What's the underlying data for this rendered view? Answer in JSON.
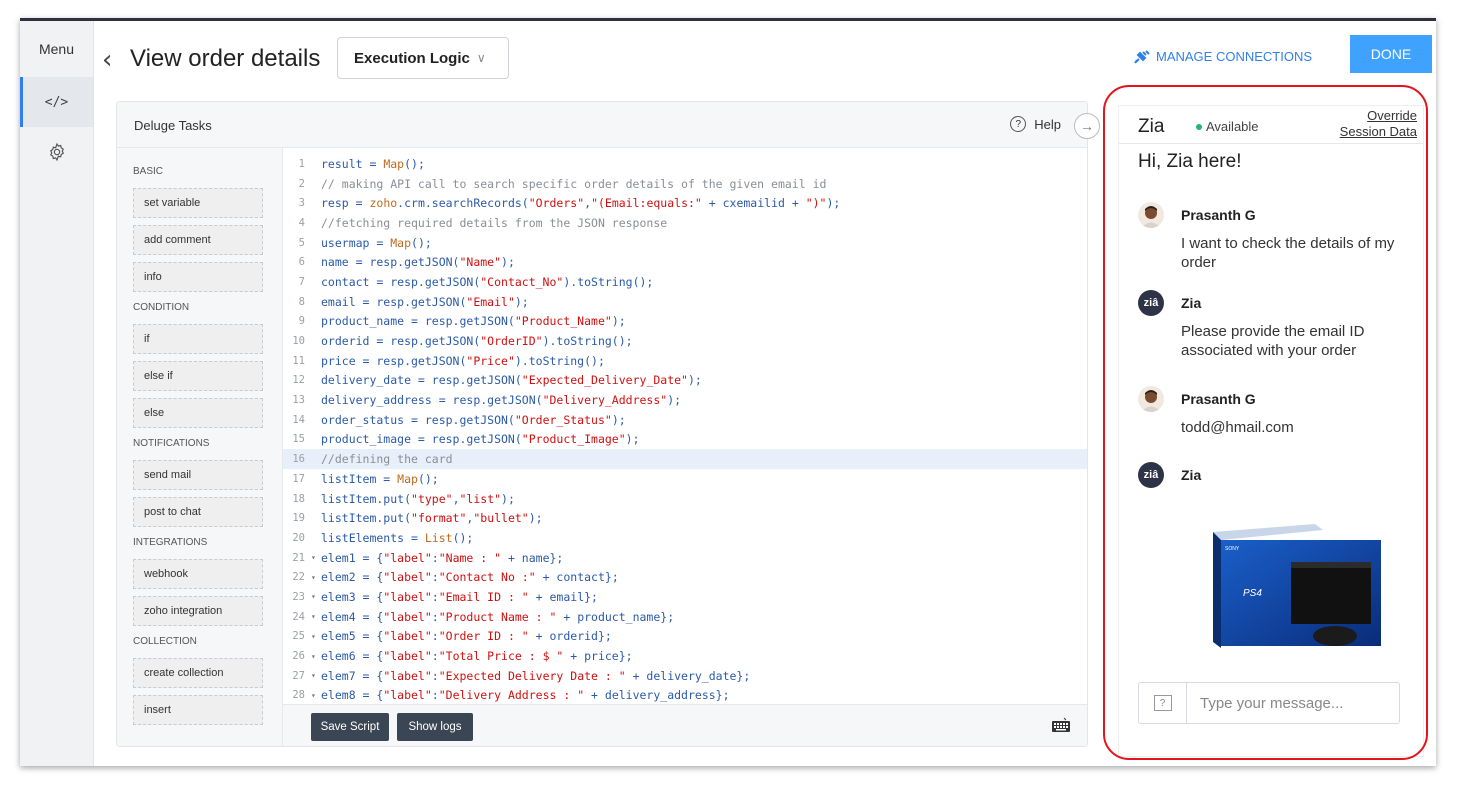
{
  "rail": {
    "menu_label": "Menu"
  },
  "header": {
    "back_icon": "chevron-left-icon",
    "title": "View order details",
    "logic_select": "Execution Logic",
    "manage_connections": "MANAGE CONNECTIONS",
    "done": "DONE",
    "accent": "#2f80ed",
    "done_bg": "#3fa2ff"
  },
  "editor": {
    "title": "Deluge Tasks",
    "help": "Help",
    "help_icon": "?",
    "sections": [
      {
        "label": "BASIC",
        "items": [
          "set variable",
          "add comment",
          "info"
        ]
      },
      {
        "label": "CONDITION",
        "items": [
          "if",
          "else if",
          "else"
        ]
      },
      {
        "label": "NOTIFICATIONS",
        "items": [
          "send mail",
          "post to chat"
        ]
      },
      {
        "label": "INTEGRATIONS",
        "items": [
          "webhook",
          "zoho integration"
        ]
      },
      {
        "label": "COLLECTION",
        "items": [
          "create collection",
          "insert"
        ]
      }
    ],
    "highlighted_line": 16,
    "code": [
      {
        "n": "1",
        "fold": false,
        "parts": [
          [
            "",
            "result = "
          ],
          [
            "fn",
            "Map"
          ],
          [
            "",
            "();"
          ]
        ]
      },
      {
        "n": "2",
        "fold": false,
        "parts": [
          [
            "cm",
            "// making API call to search specific order details of the given email id"
          ]
        ]
      },
      {
        "n": "3",
        "fold": false,
        "parts": [
          [
            "",
            "resp = "
          ],
          [
            "fn",
            "zoho"
          ],
          [
            "",
            ".crm.searchRecords("
          ],
          [
            "st",
            "\"Orders\""
          ],
          [
            "",
            ","
          ],
          [
            "st",
            "\"(Email:equals:\""
          ],
          [
            "",
            " + cxemailid + "
          ],
          [
            "st",
            "\")\""
          ],
          [
            "",
            ");"
          ]
        ]
      },
      {
        "n": "4",
        "fold": false,
        "parts": [
          [
            "cm",
            "//fetching required details from the JSON response"
          ]
        ]
      },
      {
        "n": "5",
        "fold": false,
        "parts": [
          [
            "",
            "usermap = "
          ],
          [
            "fn",
            "Map"
          ],
          [
            "",
            "();"
          ]
        ]
      },
      {
        "n": "6",
        "fold": false,
        "parts": [
          [
            "",
            "name = resp.getJSON("
          ],
          [
            "st",
            "\"Name\""
          ],
          [
            "",
            ");"
          ]
        ]
      },
      {
        "n": "7",
        "fold": false,
        "parts": [
          [
            "",
            "contact = resp.getJSON("
          ],
          [
            "st",
            "\"Contact_No\""
          ],
          [
            "",
            ").toString();"
          ]
        ]
      },
      {
        "n": "8",
        "fold": false,
        "parts": [
          [
            "",
            "email = resp.getJSON("
          ],
          [
            "st",
            "\"Email\""
          ],
          [
            "",
            ");"
          ]
        ]
      },
      {
        "n": "9",
        "fold": false,
        "parts": [
          [
            "",
            "product_name = resp.getJSON("
          ],
          [
            "st",
            "\"Product_Name\""
          ],
          [
            "",
            ");"
          ]
        ]
      },
      {
        "n": "10",
        "fold": false,
        "parts": [
          [
            "",
            "orderid = resp.getJSON("
          ],
          [
            "st",
            "\"OrderID\""
          ],
          [
            "",
            ").toString();"
          ]
        ]
      },
      {
        "n": "11",
        "fold": false,
        "parts": [
          [
            "",
            "price = resp.getJSON("
          ],
          [
            "st",
            "\"Price\""
          ],
          [
            "",
            ").toString();"
          ]
        ]
      },
      {
        "n": "12",
        "fold": false,
        "parts": [
          [
            "",
            "delivery_date = resp.getJSON("
          ],
          [
            "st",
            "\"Expected_Delivery_Date\""
          ],
          [
            "",
            ");"
          ]
        ]
      },
      {
        "n": "13",
        "fold": false,
        "parts": [
          [
            "",
            "delivery_address = resp.getJSON("
          ],
          [
            "st",
            "\"Delivery_Address\""
          ],
          [
            "",
            ");"
          ]
        ]
      },
      {
        "n": "14",
        "fold": false,
        "parts": [
          [
            "",
            "order_status = resp.getJSON("
          ],
          [
            "st",
            "\"Order_Status\""
          ],
          [
            "",
            ");"
          ]
        ]
      },
      {
        "n": "15",
        "fold": false,
        "parts": [
          [
            "",
            "product_image = resp.getJSON("
          ],
          [
            "st",
            "\"Product_Image\""
          ],
          [
            "",
            ");"
          ]
        ]
      },
      {
        "n": "16",
        "fold": false,
        "parts": [
          [
            "cm",
            "//defining the card"
          ]
        ]
      },
      {
        "n": "17",
        "fold": false,
        "parts": [
          [
            "",
            "listItem = "
          ],
          [
            "fn",
            "Map"
          ],
          [
            "",
            "();"
          ]
        ]
      },
      {
        "n": "18",
        "fold": false,
        "parts": [
          [
            "",
            "listItem.put("
          ],
          [
            "st",
            "\"type\""
          ],
          [
            "",
            ","
          ],
          [
            "st",
            "\"list\""
          ],
          [
            "",
            ");"
          ]
        ]
      },
      {
        "n": "19",
        "fold": false,
        "parts": [
          [
            "",
            "listItem.put("
          ],
          [
            "st",
            "\"format\""
          ],
          [
            "",
            ","
          ],
          [
            "st",
            "\"bullet\""
          ],
          [
            "",
            ");"
          ]
        ]
      },
      {
        "n": "20",
        "fold": false,
        "parts": [
          [
            "",
            "listElements = "
          ],
          [
            "fn",
            "List"
          ],
          [
            "",
            "();"
          ]
        ]
      },
      {
        "n": "21",
        "fold": true,
        "parts": [
          [
            "",
            "elem1 = {"
          ],
          [
            "st",
            "\"label\""
          ],
          [
            "",
            ":"
          ],
          [
            "st",
            "\"Name : \""
          ],
          [
            "",
            " + name};"
          ]
        ]
      },
      {
        "n": "22",
        "fold": true,
        "parts": [
          [
            "",
            "elem2 = {"
          ],
          [
            "st",
            "\"label\""
          ],
          [
            "",
            ":"
          ],
          [
            "st",
            "\"Contact No :\""
          ],
          [
            "",
            " + contact};"
          ]
        ]
      },
      {
        "n": "23",
        "fold": true,
        "parts": [
          [
            "",
            "elem3 = {"
          ],
          [
            "st",
            "\"label\""
          ],
          [
            "",
            ":"
          ],
          [
            "st",
            "\"Email ID : \""
          ],
          [
            "",
            " + email};"
          ]
        ]
      },
      {
        "n": "24",
        "fold": true,
        "parts": [
          [
            "",
            "elem4 = {"
          ],
          [
            "st",
            "\"label\""
          ],
          [
            "",
            ":"
          ],
          [
            "st",
            "\"Product Name : \""
          ],
          [
            "",
            " + product_name};"
          ]
        ]
      },
      {
        "n": "25",
        "fold": true,
        "parts": [
          [
            "",
            "elem5 = {"
          ],
          [
            "st",
            "\"label\""
          ],
          [
            "",
            ":"
          ],
          [
            "st",
            "\"Order ID : \""
          ],
          [
            "",
            " + orderid};"
          ]
        ]
      },
      {
        "n": "26",
        "fold": true,
        "parts": [
          [
            "",
            "elem6 = {"
          ],
          [
            "st",
            "\"label\""
          ],
          [
            "",
            ":"
          ],
          [
            "st",
            "\"Total Price : $ \""
          ],
          [
            "",
            " + price};"
          ]
        ]
      },
      {
        "n": "27",
        "fold": true,
        "parts": [
          [
            "",
            "elem7 = {"
          ],
          [
            "st",
            "\"label\""
          ],
          [
            "",
            ":"
          ],
          [
            "st",
            "\"Expected Delivery Date : \""
          ],
          [
            "",
            " + delivery_date};"
          ]
        ]
      },
      {
        "n": "28",
        "fold": true,
        "parts": [
          [
            "",
            "elem8 = {"
          ],
          [
            "st",
            "\"label\""
          ],
          [
            "",
            ":"
          ],
          [
            "st",
            "\"Delivery Address : \""
          ],
          [
            "",
            " + delivery_address};"
          ]
        ]
      }
    ],
    "save_script": "Save Script",
    "show_logs": "Show logs"
  },
  "zia": {
    "name": "Zia",
    "status": "Available",
    "override_line1": "Override",
    "override_line2": "Session Data",
    "greeting": "Hi, Zia here!",
    "messages": [
      {
        "sender": "Prasanth G",
        "kind": "user",
        "text": "I want to check the details of my order"
      },
      {
        "sender": "Zia",
        "kind": "bot",
        "text": "Please provide the email ID associated with your order"
      },
      {
        "sender": "Prasanth G",
        "kind": "user",
        "text": "todd@hmail.com"
      },
      {
        "sender": "Zia",
        "kind": "bot",
        "text": ""
      }
    ],
    "product_image": {
      "brand_text": "SONY",
      "logo_text": "PS4"
    },
    "input_placeholder": "Type your message...",
    "input_icon": "?",
    "status_color": "#22b573",
    "highlight_color": "#e3141b"
  }
}
